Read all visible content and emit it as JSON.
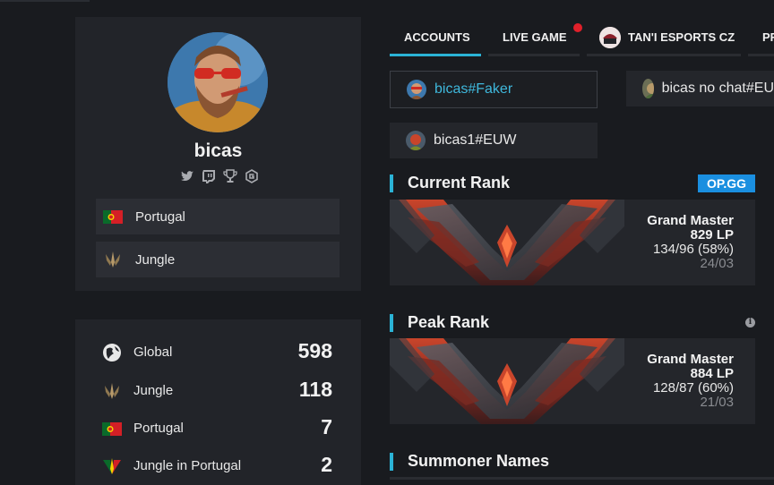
{
  "profile": {
    "username": "bicas",
    "social_icons": [
      "twitter-icon",
      "twitch-icon",
      "trophy-icon",
      "g-icon"
    ],
    "country": "Portugal",
    "role": "Jungle"
  },
  "ladder": [
    {
      "icon": "globe-icon",
      "label": "Global",
      "value": "598"
    },
    {
      "icon": "jungle-icon",
      "label": "Jungle",
      "value": "118"
    },
    {
      "icon": "portugal-flag-icon",
      "label": "Portugal",
      "value": "7"
    },
    {
      "icon": "jungle-portugal-icon",
      "label": "Jungle in Portugal",
      "value": "2"
    }
  ],
  "tabs": [
    {
      "label": "ACCOUNTS",
      "active": true
    },
    {
      "label": "LIVE GAME",
      "notification": true
    },
    {
      "label": "TAN'I ESPORTS CZ",
      "logo_text": "TAN'I"
    },
    {
      "label": "PR"
    }
  ],
  "accounts": [
    {
      "name": "bicas#Faker",
      "selected": true
    },
    {
      "name": "bicas no chat#EU"
    },
    {
      "name": "bicas1#EUW"
    }
  ],
  "current_rank": {
    "title": "Current Rank",
    "badge": "OP.GG",
    "tier": "Grand Master",
    "lp": "829 LP",
    "record": "134/96 (58%)",
    "date": "24/03"
  },
  "peak_rank": {
    "title": "Peak Rank",
    "tier": "Grand Master",
    "lp": "884 LP",
    "record": "128/87 (60%)",
    "date": "21/03"
  },
  "summoner_names": {
    "title": "Summoner Names"
  },
  "colors": {
    "accent": "#2bb3d6",
    "badge": "#1a8fe0",
    "notification": "#e0202a",
    "background": "#191b1f",
    "card": "#222429"
  }
}
